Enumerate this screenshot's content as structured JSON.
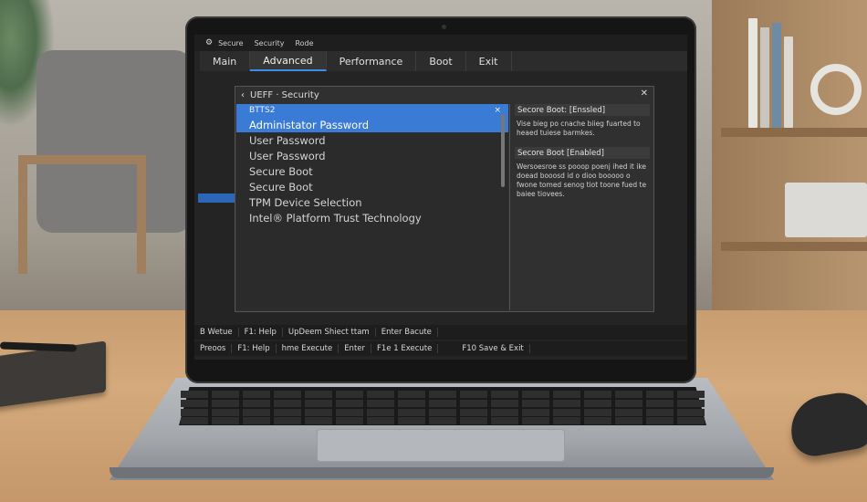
{
  "bios": {
    "title_bar": [
      "Secure",
      "Security",
      "Rode"
    ],
    "tabs": [
      {
        "label": "Main",
        "active": false
      },
      {
        "label": "Advanced",
        "active": true
      },
      {
        "label": "Performance",
        "active": false
      },
      {
        "label": "Boot",
        "active": false
      },
      {
        "label": "Exit",
        "active": false
      }
    ],
    "dialog": {
      "title": "UEFF · Security",
      "list_header": "BTTS2",
      "items": [
        {
          "label": "Administator Password",
          "selected": true
        },
        {
          "label": "User Password",
          "selected": false
        },
        {
          "label": "User Password",
          "selected": false
        },
        {
          "label": "Secure Boot",
          "selected": false
        },
        {
          "label": "Secure Boot",
          "selected": false
        },
        {
          "label": "TPM Device Selection",
          "selected": false
        },
        {
          "label": "Intel® Platform Trust Technology",
          "selected": false
        }
      ],
      "help": [
        {
          "title": "Secore Boot: [Enssled]",
          "text": "Vise bieg po cnache biieg fuarted to heaed tuiese barmkes."
        },
        {
          "title": "Secore Boot [Enabled]",
          "text": "Wersoesroe ss pooop poenj ihed it ike doead booosd id o dioo booooo o fwone tomed senog tiot toone fued te baiee tiovees."
        }
      ]
    },
    "status_bar_1": [
      "B Wetue",
      "F1: Help",
      "UpDeem Shiect ttam",
      "Enter Bacute"
    ],
    "status_bar_2": [
      "Preoos",
      "F1: Help",
      "hme Execute",
      "Enter",
      "F1e 1 Execute",
      "F10 Save & Exit"
    ]
  },
  "colors": {
    "accent": "#3a7bd5",
    "background": "#242424"
  }
}
